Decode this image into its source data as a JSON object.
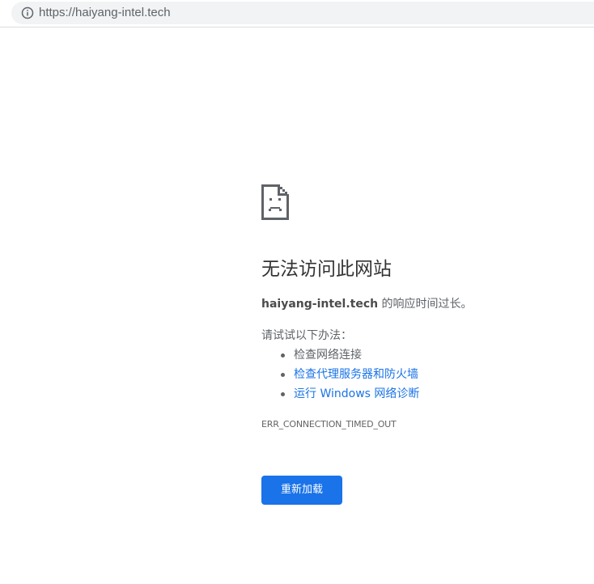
{
  "browser": {
    "url": "https://haiyang-intel.tech",
    "security_icon": "info-circle-icon"
  },
  "error_page": {
    "icon": "sad-document-icon",
    "title": "无法访问此网站",
    "summary_host": "haiyang-intel.tech",
    "summary_text": " 的响应时间过长。",
    "suggestions_intro": "请试试以下办法：",
    "suggestions": [
      {
        "label": "检查网络连接",
        "is_link": false
      },
      {
        "label": "检查代理服务器和防火墙",
        "is_link": true
      },
      {
        "label": "运行 Windows 网络诊断",
        "is_link": true
      }
    ],
    "error_code": "ERR_CONNECTION_TIMED_OUT",
    "reload_label": "重新加载"
  },
  "colors": {
    "accent": "#1a73e8",
    "link": "#1a73e8",
    "text_secondary": "#5f6368",
    "title": "#333333"
  }
}
